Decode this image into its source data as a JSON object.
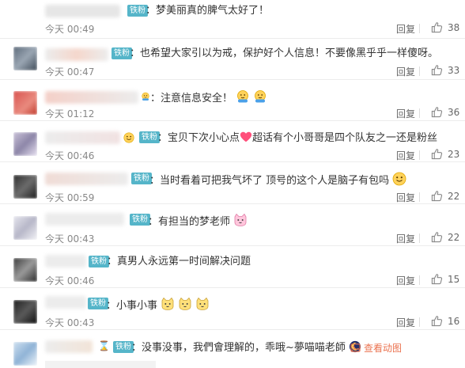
{
  "badge_label": "铁粉",
  "reply_label": "回复",
  "watch_label": "查看动图",
  "comments": [
    {
      "text": "：梦美丽真的脾气太好了！",
      "time": "今天 00:49",
      "likes": "38"
    },
    {
      "text": "：也希望大家引以为戒，保护好个人信息！不要像黑乎乎一样傻呀。",
      "time": "今天 00:47",
      "likes": "33"
    },
    {
      "text": "：注意信息安全！",
      "time": "今天 01:12",
      "likes": "36"
    },
    {
      "text_a": "：宝贝下次小心点",
      "text_b": "超话有个小哥哥是四个队友之一还是粉丝",
      "time": "今天 00:46",
      "likes": "23"
    },
    {
      "text": "：当时看着可把我气坏了 顶号的这个人是脑子有包吗",
      "time": "今天 00:59",
      "likes": "22"
    },
    {
      "text": "：有担当的梦老师",
      "time": "今天 00:43",
      "likes": "22"
    },
    {
      "text": "：真男人永远第一时间解决问题",
      "time": "今天 00:46",
      "likes": "15"
    },
    {
      "text": "：小事小事",
      "time": "今天 00:43",
      "likes": "16"
    },
    {
      "text": "：没事没事，我們會理解的，乖哦~夢喵喵老師"
    }
  ]
}
